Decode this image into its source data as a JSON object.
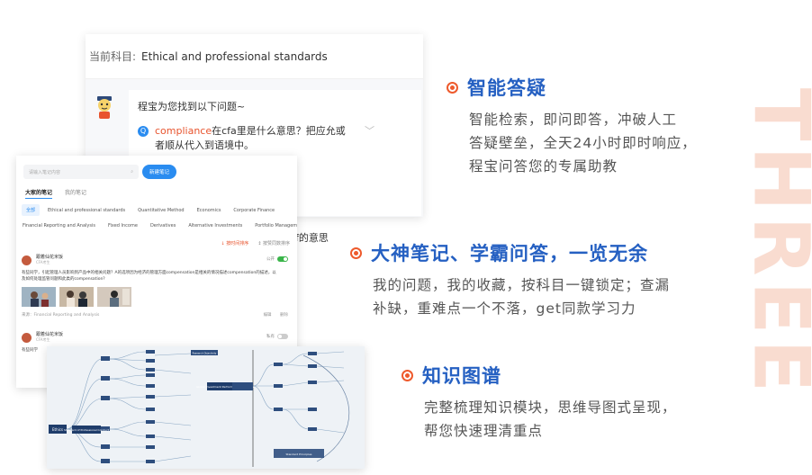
{
  "watermark": {
    "text": "THREE"
  },
  "qa_panel": {
    "subject_label": "当前科目:",
    "subject_value": "Ethical and professional standards",
    "prompt": "程宝为您找到以下问题~",
    "question": {
      "highlight": "compliance",
      "text": "在cfa里是什么意思？把应允或者顺从代入到语境中。"
    },
    "tail_text": "f的意思"
  },
  "notes_panel": {
    "search_placeholder": "请输入笔记内容",
    "new_note_label": "新建笔记",
    "tabs": [
      "大家的笔记",
      "我的笔记"
    ],
    "chips_row1": [
      "全部",
      "Ethical and professional standards",
      "Quantitative Method",
      "Economics",
      "Corporate Finance"
    ],
    "chips_row2": [
      "Financial Reporting and Analysis",
      "Fixed Income",
      "Derivatives",
      "Alternative Investments",
      "Portfolio Management"
    ],
    "sort": {
      "by_time": "按时间排序",
      "by_likes": "按赞同数排序"
    },
    "entries": [
      {
        "name": "跟着仙花米饭",
        "sub": "CFA考生",
        "toggle_label": "公开",
        "text": "有些同学，引起管理人员影响到产品中的相关问题？A的选项因为经济的管理方面compensation是相关的情况描述compensation的描述，以及如何处理监管问题和此类的compensation?",
        "footer_subject": "来源：Financial Reporting and Analysis",
        "actions": [
          "编辑",
          "删除"
        ]
      },
      {
        "name": "跟着仙花米饭",
        "sub": "CFA考生",
        "toggle_label": "私有",
        "text": "有些同学"
      }
    ]
  },
  "mindmap": {
    "nodes": [
      "Ethics",
      "Standard of Professional Conduct",
      "Research Objectivity",
      "Global Investment Performance Standards",
      "Standard Principles"
    ]
  },
  "features": [
    {
      "title": "智能答疑",
      "desc_lines": [
        "智能检索，即问即答，冲破人工",
        "答疑壁垒，全天24小时即时响应，",
        "程宝问答您的专属助教"
      ]
    },
    {
      "title": "大神笔记、学霸问答，一览无余",
      "desc_lines": [
        "我的问题，我的收藏，按科目一键锁定；查漏",
        "补缺，重难点一个不落，get同款学习力"
      ]
    },
    {
      "title": "知识图谱",
      "desc_lines": [
        "完整梳理知识模块，思维导图式呈现，",
        "帮您快速理清重点"
      ]
    }
  ],
  "colors": {
    "accent_orange": "#ee5a2c",
    "title_blue": "#2560c2",
    "link_blue": "#2a8cf0",
    "watermark": "#f9dcd0"
  }
}
